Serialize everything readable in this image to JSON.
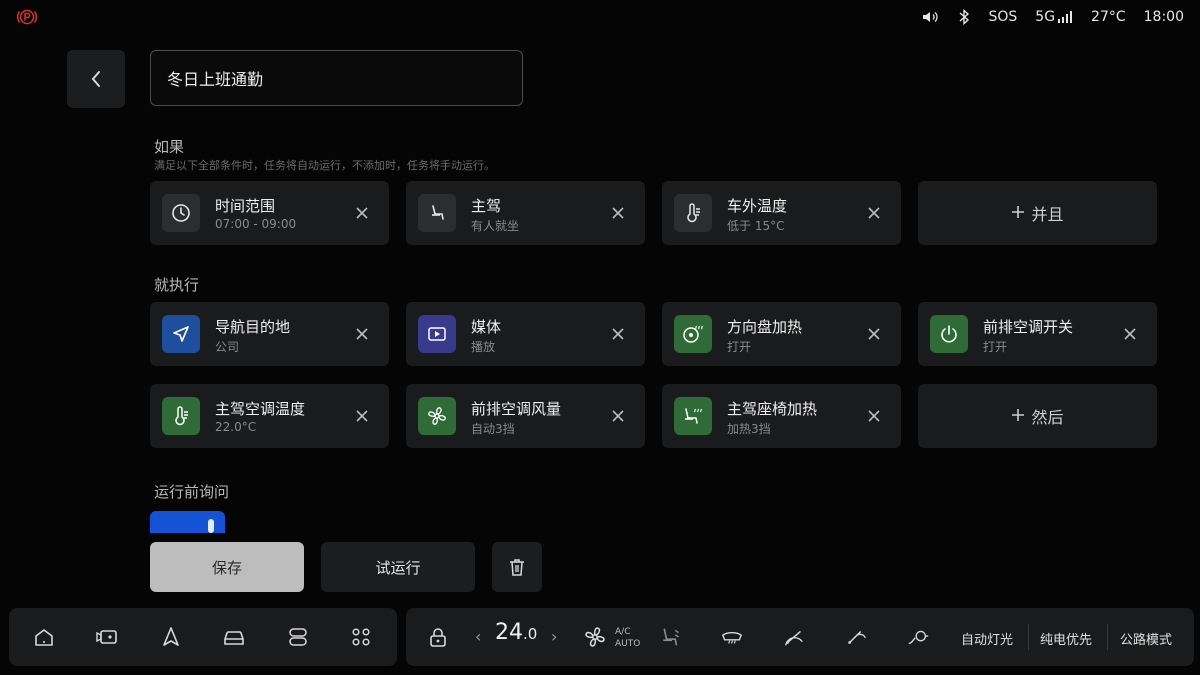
{
  "status": {
    "network": "5G",
    "sos": "SOS",
    "temperature": "27°C",
    "time": "18:00"
  },
  "header": {
    "task_name": "冬日上班通勤"
  },
  "conditions": {
    "title": "如果",
    "subtitle": "满足以下全部条件时，任务将自动运行，不添加时，任务将手动运行。",
    "items": [
      {
        "title": "时间范围",
        "sub": "07:00 - 09:00",
        "icon": "clock-icon"
      },
      {
        "title": "主驾",
        "sub": "有人就坐",
        "icon": "seat-icon"
      },
      {
        "title": "车外温度",
        "sub": "低于 15°C",
        "icon": "thermometer-icon"
      }
    ],
    "add_label": "并且"
  },
  "actions": {
    "title": "就执行",
    "items": [
      {
        "title": "导航目的地",
        "sub": "公司",
        "icon": "navigation-icon",
        "color": "#1e4f9e"
      },
      {
        "title": "媒体",
        "sub": "播放",
        "icon": "media-play-icon",
        "color": "#3a3a8c"
      },
      {
        "title": "方向盘加热",
        "sub": "打开",
        "icon": "steering-heat-icon",
        "color": "#2e6b36"
      },
      {
        "title": "前排空调开关",
        "sub": "打开",
        "icon": "power-icon",
        "color": "#2e6b36"
      },
      {
        "title": "主驾空调温度",
        "sub": "22.0°C",
        "icon": "thermometer-icon",
        "color": "#2e6b36"
      },
      {
        "title": "前排空调风量",
        "sub": "自动3挡",
        "icon": "fan-icon",
        "color": "#2e6b36"
      },
      {
        "title": "主驾座椅加热",
        "sub": "加热3挡",
        "icon": "seat-heat-icon",
        "color": "#2e6b36"
      }
    ],
    "add_label": "然后"
  },
  "ask_before_run": {
    "title": "运行前询问",
    "enabled": true
  },
  "buttons": {
    "save": "保存",
    "try_run": "试运行"
  },
  "dock": {
    "temp_int": "24",
    "temp_dec": ".0",
    "ac_line1": "A/C",
    "ac_line2": "AUTO",
    "auto_light": "自动灯光",
    "ev_priority": "纯电优先",
    "road_mode": "公路模式"
  }
}
